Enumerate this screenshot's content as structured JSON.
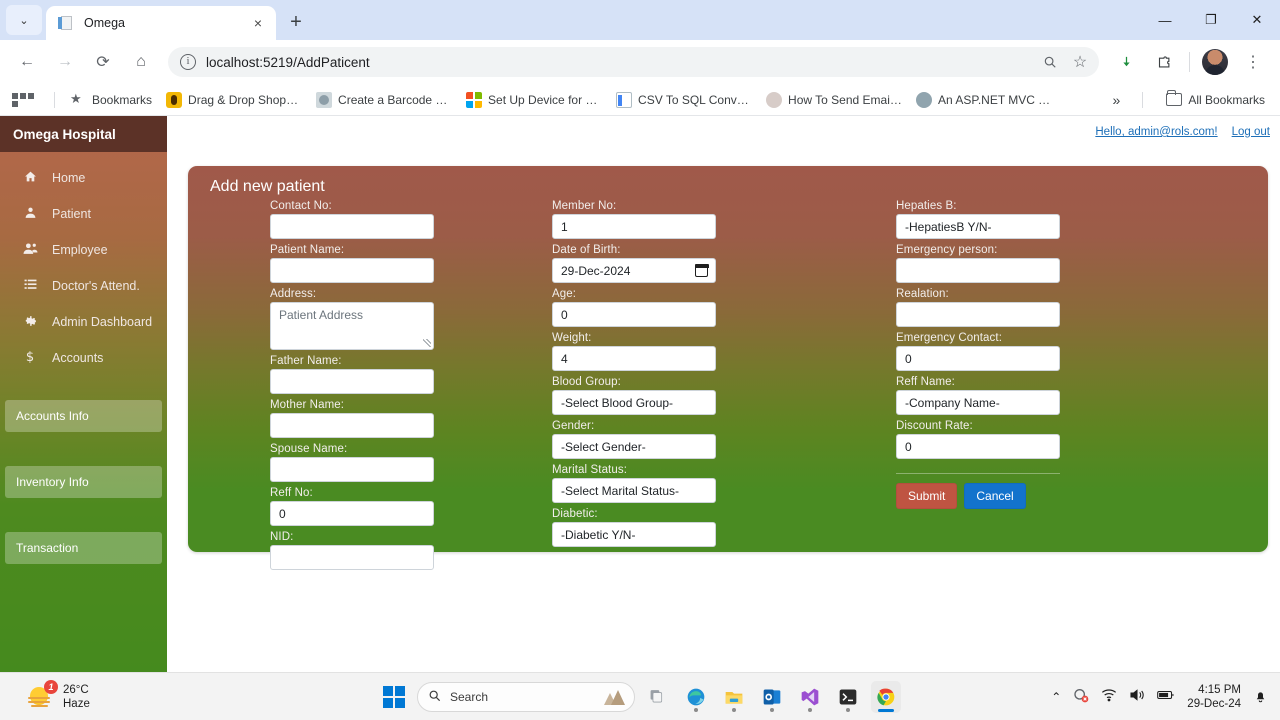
{
  "browser": {
    "tab": {
      "title": "Omega",
      "favicon": "document-icon",
      "close_label": "×"
    },
    "tab_list_chevron": "⌄",
    "new_tab_label": "+",
    "window_controls": {
      "minimize": "—",
      "maximize": "❐",
      "close": "✕"
    },
    "nav": {
      "back": "←",
      "forward": "→",
      "reload": "⟳",
      "home": "⌂"
    },
    "omnibox": {
      "info_icon": "ⓘ",
      "url": "localhost:5219/AddPaticent",
      "zoom_search_icon": "search-icon",
      "bookmark_icon": "☆"
    },
    "actions": {
      "download_icon": "⬇",
      "extensions_icon": "extensions-icon",
      "profile": "avatar",
      "menu": "⋮"
    },
    "bookmarks": [
      {
        "label": "Bookmarks",
        "icon": "star-icon"
      },
      {
        "label": "Drag & Drop Shopp...",
        "icon": "yellow-icon"
      },
      {
        "label": "Create a Barcode Sc...",
        "icon": "photo-icon"
      },
      {
        "label": "Set Up Device for D...",
        "icon": "microsoft-icon"
      },
      {
        "label": "CSV To SQL Convert...",
        "icon": "doc-icon"
      },
      {
        "label": "How To Send Email...",
        "icon": "person-icon"
      },
      {
        "label": "An ASP.NET MVC Tr...",
        "icon": "person2-icon"
      }
    ],
    "bookmarks_overflow": "»",
    "all_bookmarks": "All Bookmarks"
  },
  "sidebar": {
    "brand": "Omega Hospital",
    "items": [
      {
        "label": "Home",
        "icon": "home-icon",
        "glyph": "⌂"
      },
      {
        "label": "Patient",
        "icon": "user-icon",
        "glyph": "👤"
      },
      {
        "label": "Employee",
        "icon": "users-icon",
        "glyph": "👥"
      },
      {
        "label": "Doctor's Attend.",
        "icon": "list-icon",
        "glyph": "☰"
      },
      {
        "label": "Admin Dashboard",
        "icon": "gear-icon",
        "glyph": "⚙"
      },
      {
        "label": "Accounts",
        "icon": "dollar-icon",
        "glyph": "$"
      }
    ],
    "buttons": [
      {
        "label": "Accounts Info"
      },
      {
        "label": "Inventory Info"
      },
      {
        "label": "Transaction"
      }
    ]
  },
  "topbar": {
    "greeting": "Hello, admin@rols.com!",
    "logout": "Log out"
  },
  "form": {
    "title": "Add new patient",
    "columns": [
      {
        "fields": [
          {
            "label": "Contact No:",
            "type": "text",
            "value": "",
            "placeholder": ""
          },
          {
            "label": "Patient Name:",
            "type": "text",
            "value": "",
            "placeholder": ""
          },
          {
            "label": "Address:",
            "type": "textarea",
            "value": "",
            "placeholder": "Patient Address"
          },
          {
            "label": "Father Name:",
            "type": "text",
            "value": "",
            "placeholder": ""
          },
          {
            "label": "Mother Name:",
            "type": "text",
            "value": "",
            "placeholder": ""
          },
          {
            "label": "Spouse Name:",
            "type": "text",
            "value": "",
            "placeholder": ""
          },
          {
            "label": "Reff No:",
            "type": "number",
            "value": "0",
            "placeholder": ""
          },
          {
            "label": "NID:",
            "type": "text",
            "value": "",
            "placeholder": ""
          }
        ]
      },
      {
        "fields": [
          {
            "label": "Member No:",
            "type": "number",
            "value": "1",
            "placeholder": ""
          },
          {
            "label": "Date of Birth:",
            "type": "date",
            "value": "29-Dec-2024",
            "placeholder": ""
          },
          {
            "label": "Age:",
            "type": "number",
            "value": "0",
            "placeholder": ""
          },
          {
            "label": "Weight:",
            "type": "number",
            "value": "4",
            "placeholder": ""
          },
          {
            "label": "Blood Group:",
            "type": "select",
            "value": "-Select Blood Group-",
            "placeholder": ""
          },
          {
            "label": "Gender:",
            "type": "select",
            "value": "-Select Gender-",
            "placeholder": ""
          },
          {
            "label": "Marital Status:",
            "type": "select",
            "value": "-Select Marital Status-",
            "placeholder": ""
          },
          {
            "label": "Diabetic:",
            "type": "select",
            "value": "-Diabetic Y/N-",
            "placeholder": ""
          }
        ]
      },
      {
        "fields": [
          {
            "label": "Hepaties B:",
            "type": "select",
            "value": "-HepatiesB Y/N-",
            "placeholder": ""
          },
          {
            "label": "Emergency person:",
            "type": "text",
            "value": "",
            "placeholder": ""
          },
          {
            "label": "Realation:",
            "type": "text",
            "value": "",
            "placeholder": ""
          },
          {
            "label": "Emergency Contact:",
            "type": "number",
            "value": "0",
            "placeholder": ""
          },
          {
            "label": "Reff Name:",
            "type": "select",
            "value": "-Company Name-",
            "placeholder": ""
          },
          {
            "label": "Discount Rate:",
            "type": "number",
            "value": "0",
            "placeholder": ""
          }
        ]
      }
    ],
    "submit_label": "Submit",
    "cancel_label": "Cancel"
  },
  "taskbar": {
    "weather": {
      "temp": "26°C",
      "condition": "Haze",
      "badge": "1"
    },
    "search_placeholder": "Search",
    "apps": [
      {
        "name": "task-view",
        "running": false
      },
      {
        "name": "edge",
        "running": true
      },
      {
        "name": "file-explorer",
        "running": true
      },
      {
        "name": "outlook",
        "running": true
      },
      {
        "name": "visual-studio",
        "running": true
      },
      {
        "name": "terminal",
        "running": true
      },
      {
        "name": "chrome",
        "running": true,
        "active": true
      }
    ],
    "tray": {
      "chevron": "⌃",
      "antivirus": "shield-icon",
      "wifi": "📶",
      "volume": "🔊",
      "battery": "battery-icon"
    },
    "clock": {
      "time": "4:15 PM",
      "date": "29-Dec-24"
    },
    "notification": "notification-icon"
  },
  "colors": {
    "brand_dark": "#5c3227",
    "card_top": "#a0594a",
    "card_bottom": "#4a8b22",
    "submit": "#bf5442",
    "cancel": "#1373cc",
    "link": "#1d6fb8"
  }
}
